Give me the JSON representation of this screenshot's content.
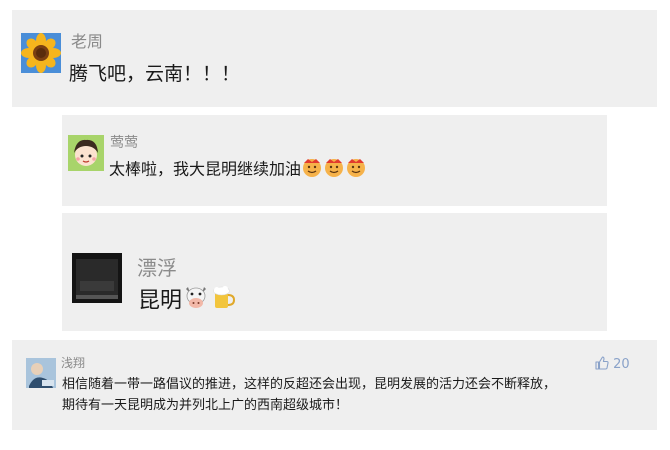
{
  "comments": [
    {
      "name": "老周",
      "text": "腾飞吧，云南！！！"
    },
    {
      "name": "莺莺",
      "text": "太棒啦，我大昆明继续加油"
    },
    {
      "name": "漂浮",
      "text": "昆明"
    },
    {
      "name": "浅翔",
      "likes": "20",
      "text_line1": "相信随着一带一路倡议的推进，这样的反超还会出现，昆明发展的活力还会不断释放，",
      "text_line2": "期待有一天昆明成为并列北上广的西南超级城市！"
    }
  ],
  "icons": {
    "thumb": "thumbs-up-icon",
    "emoji_face": "smiling-face-emoji",
    "emoji_cow": "cow-face-emoji",
    "emoji_beer": "beer-mug-emoji"
  },
  "colors": {
    "card_bg": "#efefef",
    "name": "#8a8a8a",
    "like": "#8aa2c9"
  }
}
